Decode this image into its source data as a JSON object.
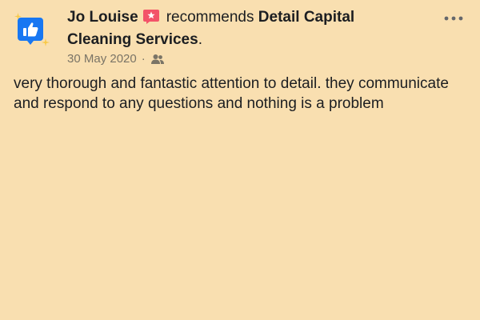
{
  "post": {
    "author": "Jo Louise",
    "verb": "recommends",
    "page_name": "Detail Capital Cleaning Services",
    "page_suffix": ".",
    "date": "30 May 2020",
    "separator": "·",
    "audience_icon": "friends-icon",
    "more_icon": "more-options-icon",
    "recommend_icon": "thumbs-up-icon",
    "body": "very thorough and fantastic attention to detail. they communicate and respond to any questions and nothing is a problem"
  },
  "colors": {
    "background": "#f9dfb0",
    "accent_blue": "#1877f2",
    "badge_pink": "#f35369",
    "meta_gray": "#7a7466",
    "sparkle_yellow": "#f7c948"
  }
}
